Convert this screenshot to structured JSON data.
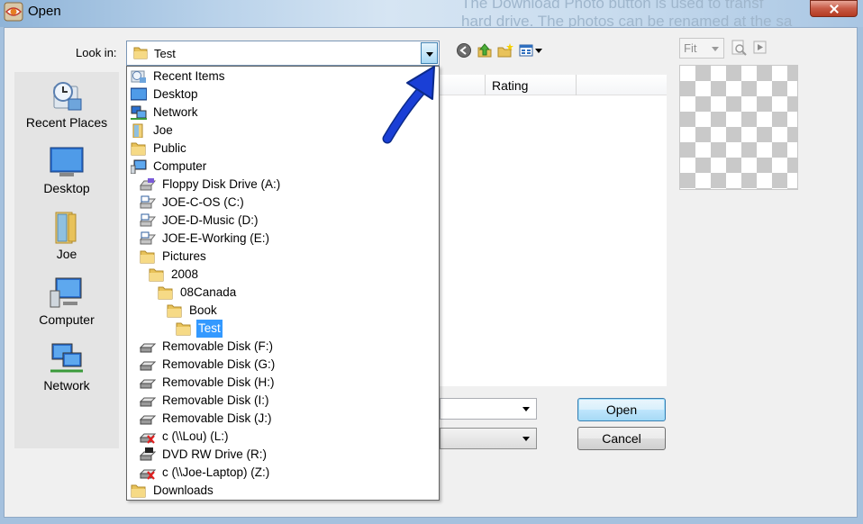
{
  "window": {
    "title": "Open",
    "background_text": [
      "The Download Photo button is used to transf",
      "hard drive. The photos can be renamed at the sa"
    ]
  },
  "look_in": {
    "label": "Look in:",
    "value": "Test"
  },
  "toolbar": {
    "icons": [
      "back-icon",
      "up-folder-icon",
      "new-folder-icon",
      "view-menu-icon"
    ]
  },
  "places": [
    {
      "label": "Recent Places",
      "icon": "recent-places-icon"
    },
    {
      "label": "Desktop",
      "icon": "desktop-icon"
    },
    {
      "label": "Joe",
      "icon": "user-folder-icon"
    },
    {
      "label": "Computer",
      "icon": "computer-icon"
    },
    {
      "label": "Network",
      "icon": "network-icon"
    }
  ],
  "file_list": {
    "columns": [
      "Rating"
    ]
  },
  "dropdown": {
    "items": [
      {
        "label": "Recent Items",
        "icon": "recent-items-icon",
        "level": 0
      },
      {
        "label": "Desktop",
        "icon": "desktop-icon",
        "level": 0
      },
      {
        "label": "Network",
        "icon": "network-icon",
        "level": 1
      },
      {
        "label": "Joe",
        "icon": "user-folder-icon",
        "level": 1
      },
      {
        "label": "Public",
        "icon": "folder-icon",
        "level": 1
      },
      {
        "label": "Computer",
        "icon": "computer-icon",
        "level": 1
      },
      {
        "label": "Floppy Disk Drive (A:)",
        "icon": "floppy-drive-icon",
        "level": 2
      },
      {
        "label": "JOE-C-OS (C:)",
        "icon": "hard-drive-icon",
        "level": 2
      },
      {
        "label": "JOE-D-Music (D:)",
        "icon": "hard-drive-icon",
        "level": 2
      },
      {
        "label": "JOE-E-Working (E:)",
        "icon": "hard-drive-icon",
        "level": 2
      },
      {
        "label": "Pictures",
        "icon": "folder-icon",
        "level": 3
      },
      {
        "label": "2008",
        "icon": "folder-icon",
        "level": 4
      },
      {
        "label": "08Canada",
        "icon": "folder-icon",
        "level": 5
      },
      {
        "label": "Book",
        "icon": "folder-icon",
        "level": 6
      },
      {
        "label": "Test",
        "icon": "folder-icon",
        "level": 7,
        "selected": true
      },
      {
        "label": "Removable Disk (F:)",
        "icon": "removable-disk-icon",
        "level": 2
      },
      {
        "label": "Removable Disk (G:)",
        "icon": "removable-disk-icon",
        "level": 2
      },
      {
        "label": "Removable Disk (H:)",
        "icon": "removable-disk-icon",
        "level": 2
      },
      {
        "label": "Removable Disk (I:)",
        "icon": "removable-disk-icon",
        "level": 2
      },
      {
        "label": "Removable Disk (J:)",
        "icon": "removable-disk-icon",
        "level": 2
      },
      {
        "label": "c (\\\\Lou) (L:)",
        "icon": "disconnected-network-drive-icon",
        "level": 2
      },
      {
        "label": "DVD RW Drive (R:)",
        "icon": "dvd-drive-icon",
        "level": 2
      },
      {
        "label": "c (\\\\Joe-Laptop) (Z:)",
        "icon": "disconnected-network-drive-icon",
        "level": 2
      },
      {
        "label": "Downloads",
        "icon": "folder-icon",
        "level": 1
      }
    ]
  },
  "buttons": {
    "open": "Open",
    "cancel": "Cancel"
  },
  "preview": {
    "zoom": "Fit"
  },
  "annotation": {
    "icon": "blue-arrow-icon",
    "color": "#1a3fd6"
  }
}
